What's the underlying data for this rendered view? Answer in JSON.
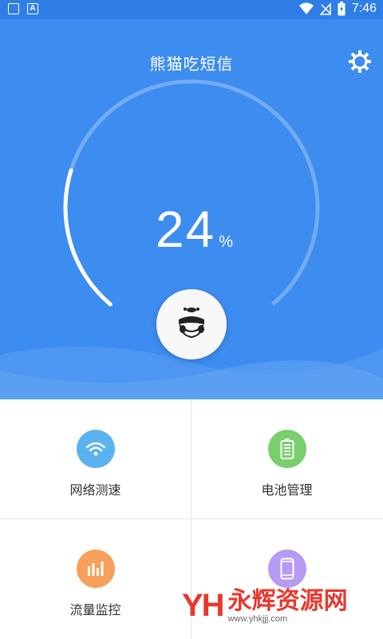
{
  "status_bar": {
    "time": "7:46",
    "left_icons": [
      "image-icon",
      "a-icon"
    ],
    "right_icons": [
      "wifi-icon",
      "no-signal-icon",
      "battery-charging-icon"
    ]
  },
  "header": {
    "title": "熊猫吃短信",
    "settings_icon": "gear-icon"
  },
  "gauge": {
    "value": "24",
    "unit": "%",
    "progress_fraction": 0.24
  },
  "features": [
    {
      "label": "网络测速",
      "icon": "wifi-icon",
      "color": "#5ab3ee"
    },
    {
      "label": "电池管理",
      "icon": "battery-icon",
      "color": "#79cf6e"
    },
    {
      "label": "流量监控",
      "icon": "bar-chart-icon",
      "color": "#f6a05b"
    },
    {
      "label": "",
      "icon": "phone-icon",
      "color": "#b79af2"
    }
  ],
  "watermark": {
    "logo": "YH",
    "text": "永辉资源网",
    "url": "www.yhkjjj.com"
  },
  "colors": {
    "hero_blue": "#3d8cf0",
    "status_bar_blue": "#2f7ee8"
  }
}
